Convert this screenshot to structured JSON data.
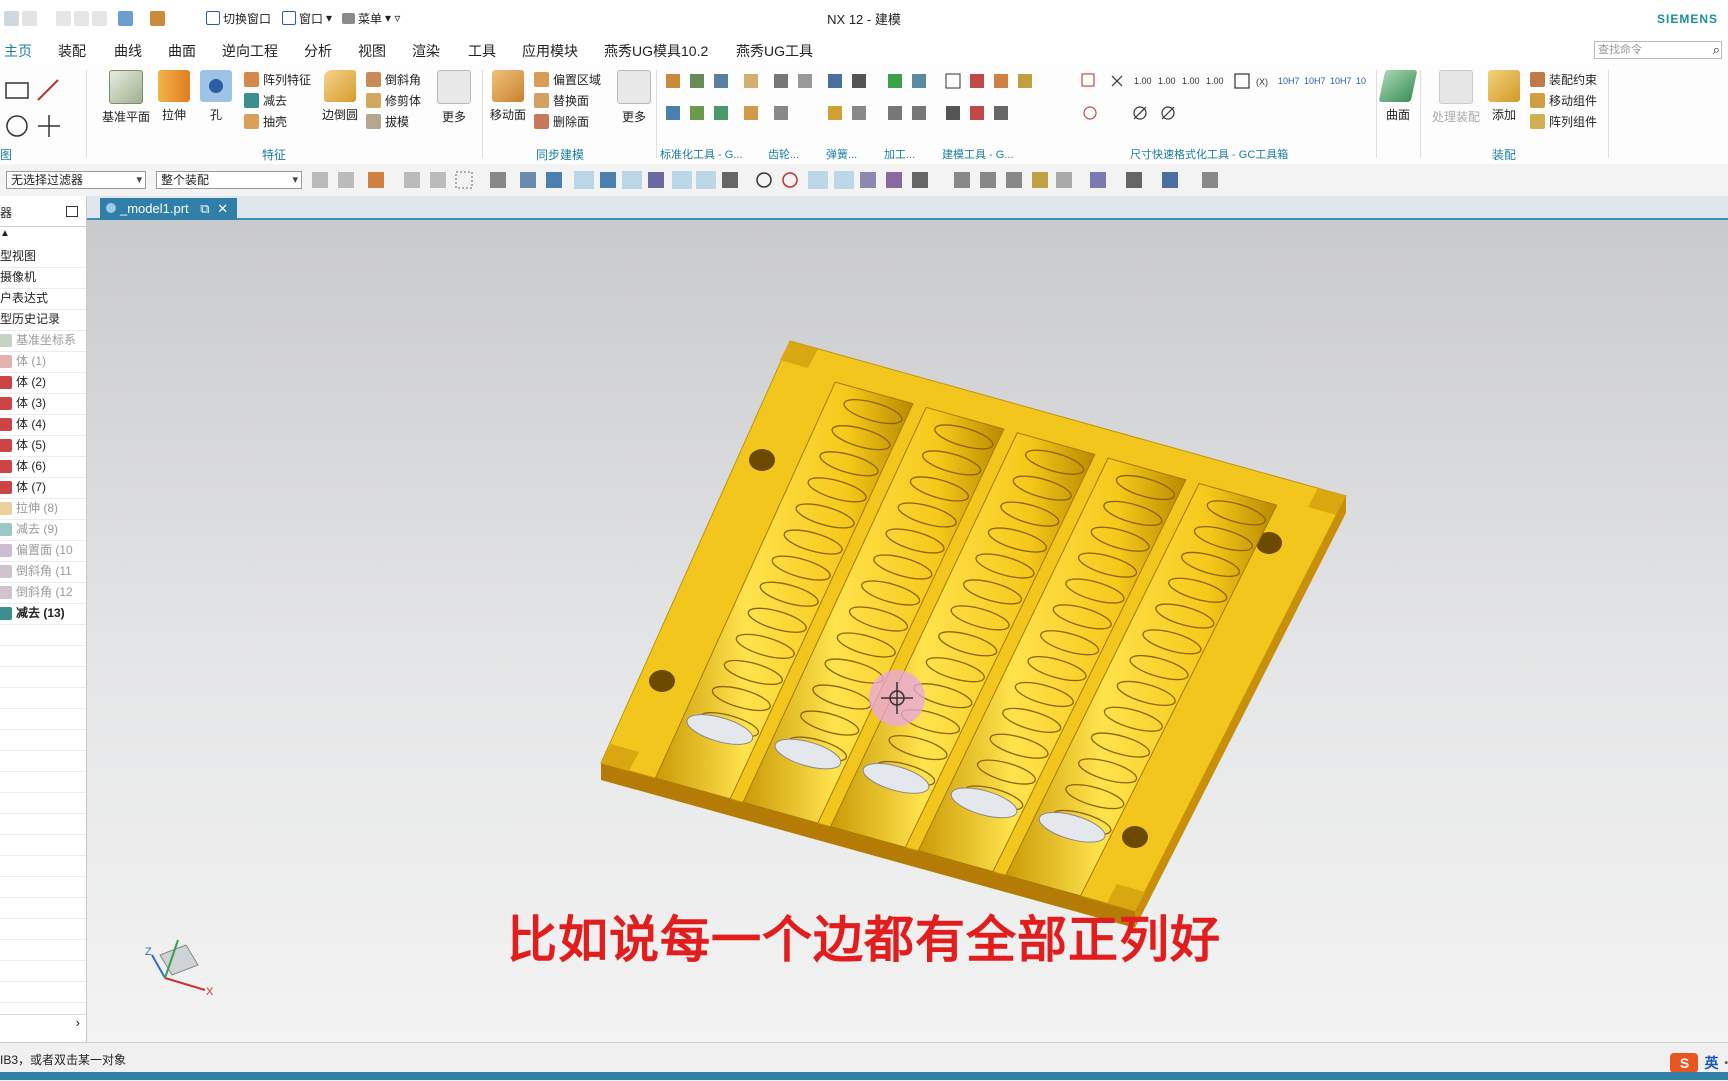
{
  "window": {
    "title": "NX 12 - 建模",
    "brand": "SIEMENS"
  },
  "quick_access": {
    "switch_window": "切换窗口",
    "window": "窗口",
    "menu": "菜单"
  },
  "tabs": [
    "主页",
    "装配",
    "曲线",
    "曲面",
    "逆向工程",
    "分析",
    "视图",
    "渲染",
    "工具",
    "应用模块",
    "燕秀UG模具10.2",
    "燕秀UG工具"
  ],
  "command_search": {
    "placeholder": "查找命令"
  },
  "ribbon": {
    "direct_sketch_label": "图",
    "feature": {
      "label": "特征",
      "datum_plane": "基准平面",
      "extrude": "拉伸",
      "hole": "孔",
      "pattern_feature": "阵列特征",
      "subtract": "减去",
      "shell": "抽壳",
      "edge_blend": "边倒圆",
      "chamfer": "倒斜角",
      "trim_body": "修剪体",
      "draft": "拔模",
      "more": "更多"
    },
    "sync": {
      "label": "同步建模",
      "move_face": "移动面",
      "offset_region": "偏置区域",
      "replace_face": "替换面",
      "delete_face": "删除面",
      "more": "更多"
    },
    "std_tools_label": "标准化工具 - G...",
    "gear_label": "齿轮...",
    "spring_label": "弹簧...",
    "machining_label": "加工...",
    "modeling_tools_label": "建模工具 - G...",
    "dim_label": "尺寸快速格式化工具 - GC工具箱",
    "surface": {
      "label": "曲面"
    },
    "assembly": {
      "label": "装配",
      "process_assembly": "处理装配",
      "add": "添加",
      "constraint": "装配约束",
      "move_component": "移动组件",
      "pattern_component": "阵列组件"
    }
  },
  "selection_bar": {
    "filter": "无选择过滤器",
    "scope": "整个装配"
  },
  "navigator": {
    "title": "器",
    "rows": [
      {
        "label": "型视图",
        "style": "normal"
      },
      {
        "label": "摄像机",
        "style": "normal"
      },
      {
        "label": "户表达式",
        "style": "normal"
      },
      {
        "label": "型历史记录",
        "style": "normal"
      },
      {
        "label": "基准坐标系",
        "style": "dim"
      },
      {
        "label": "体 (1)",
        "style": "dim"
      },
      {
        "label": "体 (2)",
        "style": "normal"
      },
      {
        "label": "体 (3)",
        "style": "normal"
      },
      {
        "label": "体 (4)",
        "style": "normal"
      },
      {
        "label": "体 (5)",
        "style": "normal"
      },
      {
        "label": "体 (6)",
        "style": "normal"
      },
      {
        "label": "体 (7)",
        "style": "normal"
      },
      {
        "label": "拉伸 (8)",
        "style": "dim"
      },
      {
        "label": "减去 (9)",
        "style": "dim"
      },
      {
        "label": "偏置面 (10",
        "style": "dim"
      },
      {
        "label": "倒斜角 (11",
        "style": "dim"
      },
      {
        "label": "倒斜角 (12",
        "style": "dim"
      },
      {
        "label": "减去 (13)",
        "style": "bold"
      }
    ]
  },
  "document_tab": {
    "name": "_model1.prt"
  },
  "subtitle": "比如说每一个边都有全部正列好",
  "status": {
    "text": "IB3，或者双击某一对象",
    "ime": "英"
  },
  "colors": {
    "accent": "#1a7fa0",
    "part_yellow": "#f5c518",
    "subtitle_red": "#e21d1d"
  }
}
